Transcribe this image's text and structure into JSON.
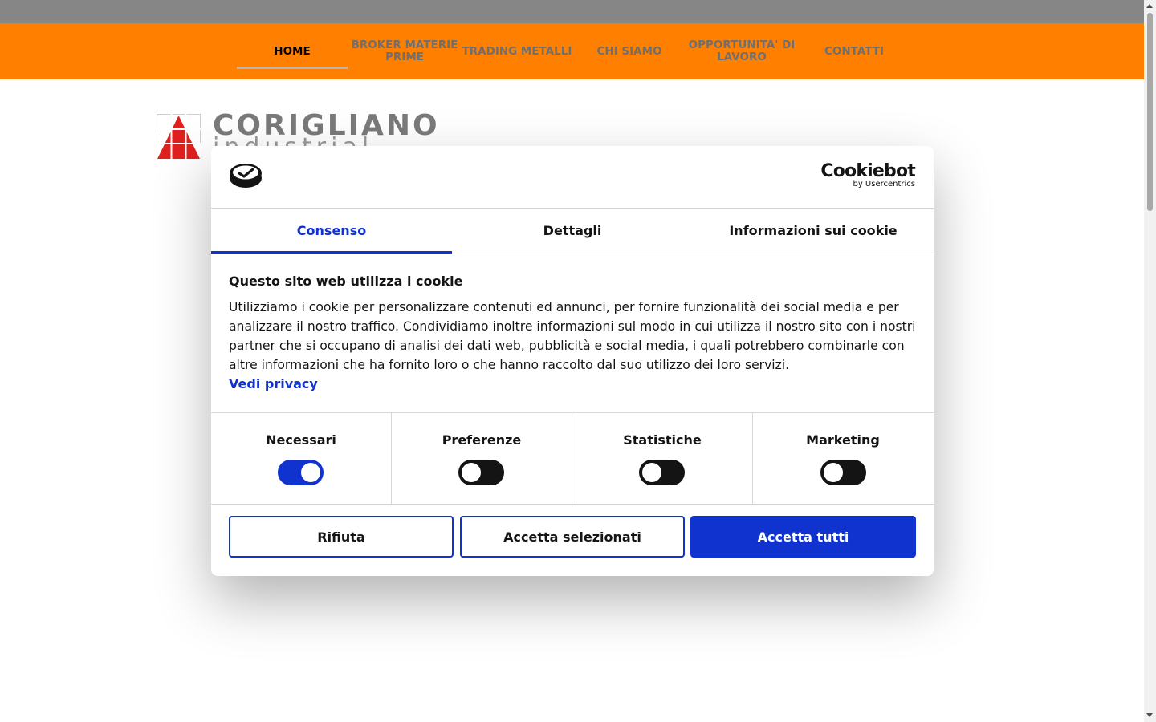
{
  "nav": {
    "items": [
      {
        "label": [
          "HOME"
        ],
        "active": true
      },
      {
        "label": [
          "BROKER MATERIE",
          "PRIME"
        ],
        "active": false
      },
      {
        "label": [
          "TRADING METALLI"
        ],
        "active": false
      },
      {
        "label": [
          "CHI SIAMO"
        ],
        "active": false
      },
      {
        "label": [
          "OPPORTUNITA' DI",
          "LAVORO"
        ],
        "active": false
      },
      {
        "label": [
          "CONTATTI"
        ],
        "active": false
      }
    ]
  },
  "logo": {
    "name": "CORIGLIANO",
    "sub": "industrial",
    "icon": "corigliano-triangle-logo"
  },
  "cookie_dialog": {
    "brand": "Cookiebot",
    "brand_sub": "by Usercentrics",
    "tabs": [
      "Consenso",
      "Dettagli",
      "Informazioni sui cookie"
    ],
    "active_tab": "Consenso",
    "title": "Questo sito web utilizza i cookie",
    "body": "Utilizziamo i cookie per personalizzare contenuti ed annunci, per fornire funzionalità dei social media e per analizzare il nostro traffico. Condividiamo inoltre informazioni sul modo in cui utilizza il nostro sito con i nostri partner che si occupano di analisi dei dati web, pubblicità e social media, i quali potrebbero combinarle con altre informazioni che ha fornito loro o che hanno raccolto dal suo utilizzo dei loro servizi.",
    "privacy_link": "Vedi privacy",
    "toggles": [
      {
        "label": "Necessari",
        "on": true
      },
      {
        "label": "Preferenze",
        "on": false
      },
      {
        "label": "Statistiche",
        "on": false
      },
      {
        "label": "Marketing",
        "on": false
      }
    ],
    "buttons": {
      "reject": "Rifiuta",
      "accept_selected": "Accetta selezionati",
      "accept_all": "Accetta tutti"
    }
  },
  "colors": {
    "nav_bg": "#ff8000",
    "top_grey": "#868686",
    "accent_blue": "#1032cf",
    "logo_red": "#e0201e"
  }
}
